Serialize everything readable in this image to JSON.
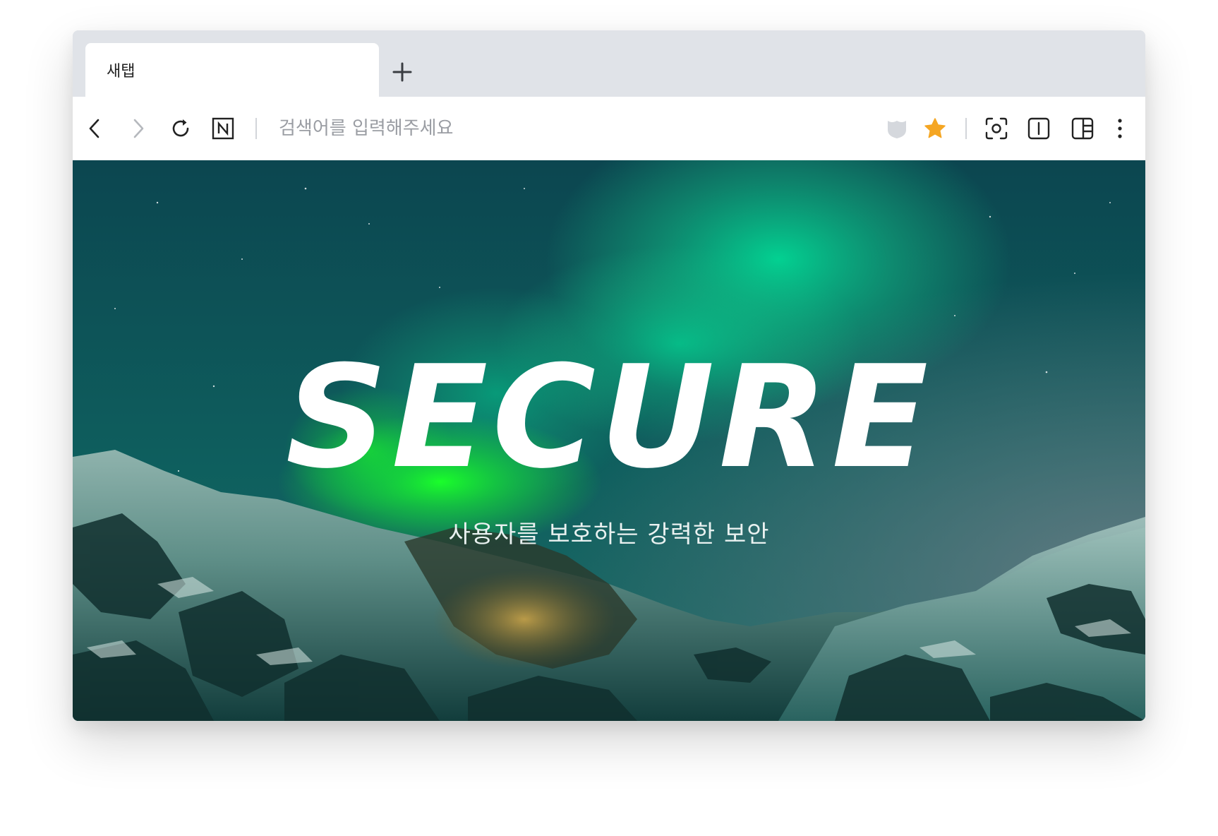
{
  "tabs": [
    {
      "title": "새탭"
    }
  ],
  "new_tab_icon": "plus-icon",
  "toolbar": {
    "address_placeholder": "검색어를 입력해주세요",
    "icons": [
      "back-arrow-icon",
      "forward-arrow-icon",
      "reload-icon",
      "naver-n-icon",
      "shield-icon",
      "star-icon",
      "screenshot-capture-icon",
      "text-cursor-icon",
      "side-panel-icon",
      "more-vertical-icon"
    ]
  },
  "colors": {
    "tabbar_bg": "#e0e3e8",
    "star_accent": "#f5a623",
    "shield_gray": "#d5d8dd",
    "aurora_green": "#00e56b",
    "sky_teal": "#0b4a4e"
  },
  "hero": {
    "title": "SECURE",
    "subtitle": "사용자를 보호하는 강력한 보안"
  }
}
